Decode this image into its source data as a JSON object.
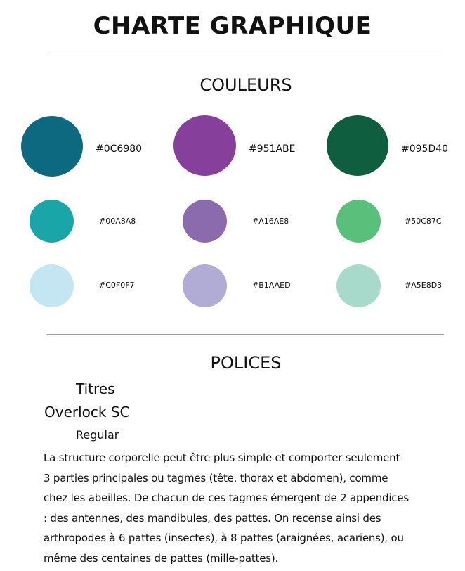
{
  "page": {
    "title": "CHARTE GRAPHIQUE"
  },
  "colors_section": {
    "title": "COULEURS",
    "rows": [
      [
        {
          "hex": "#0C6980",
          "color": "#0C6980"
        },
        {
          "hex": "#951ABE",
          "color": "#873F9C"
        },
        {
          "hex": "#095D40",
          "color": "#0F5E40"
        }
      ],
      [
        {
          "hex": "#00A8A8",
          "color": "#1AA6A8"
        },
        {
          "hex": "#A16AE8",
          "color": "#8B6BAE"
        },
        {
          "hex": "#50C87C",
          "color": "#58C07A"
        }
      ],
      [
        {
          "hex": "#C0F0F7",
          "color": "#C4E6F2"
        },
        {
          "hex": "#B1AAED",
          "color": "#B1ACD6"
        },
        {
          "hex": "#A5E8D3",
          "color": "#A8DACC"
        }
      ]
    ]
  },
  "fonts_section": {
    "title": "POLICES",
    "titles_label": "Titres",
    "font_name": "Overlock SC",
    "font_style": "Regular",
    "paragraph_lines": [
      "La structure corporelle peut être plus simple et comporter seulement",
      "3 parties principales ou tagmes (tête, thorax et abdomen), comme",
      "chez les abeilles. De chacun de ces tagmes émergent de 2 appendices",
      ": des antennes, des mandibules, des pattes. On recense ainsi des",
      "arthropodes à 6 pattes (insectes), à 8 pattes (araignées, acariens), ou",
      "même des centaines de pattes (mille-pattes)."
    ]
  }
}
